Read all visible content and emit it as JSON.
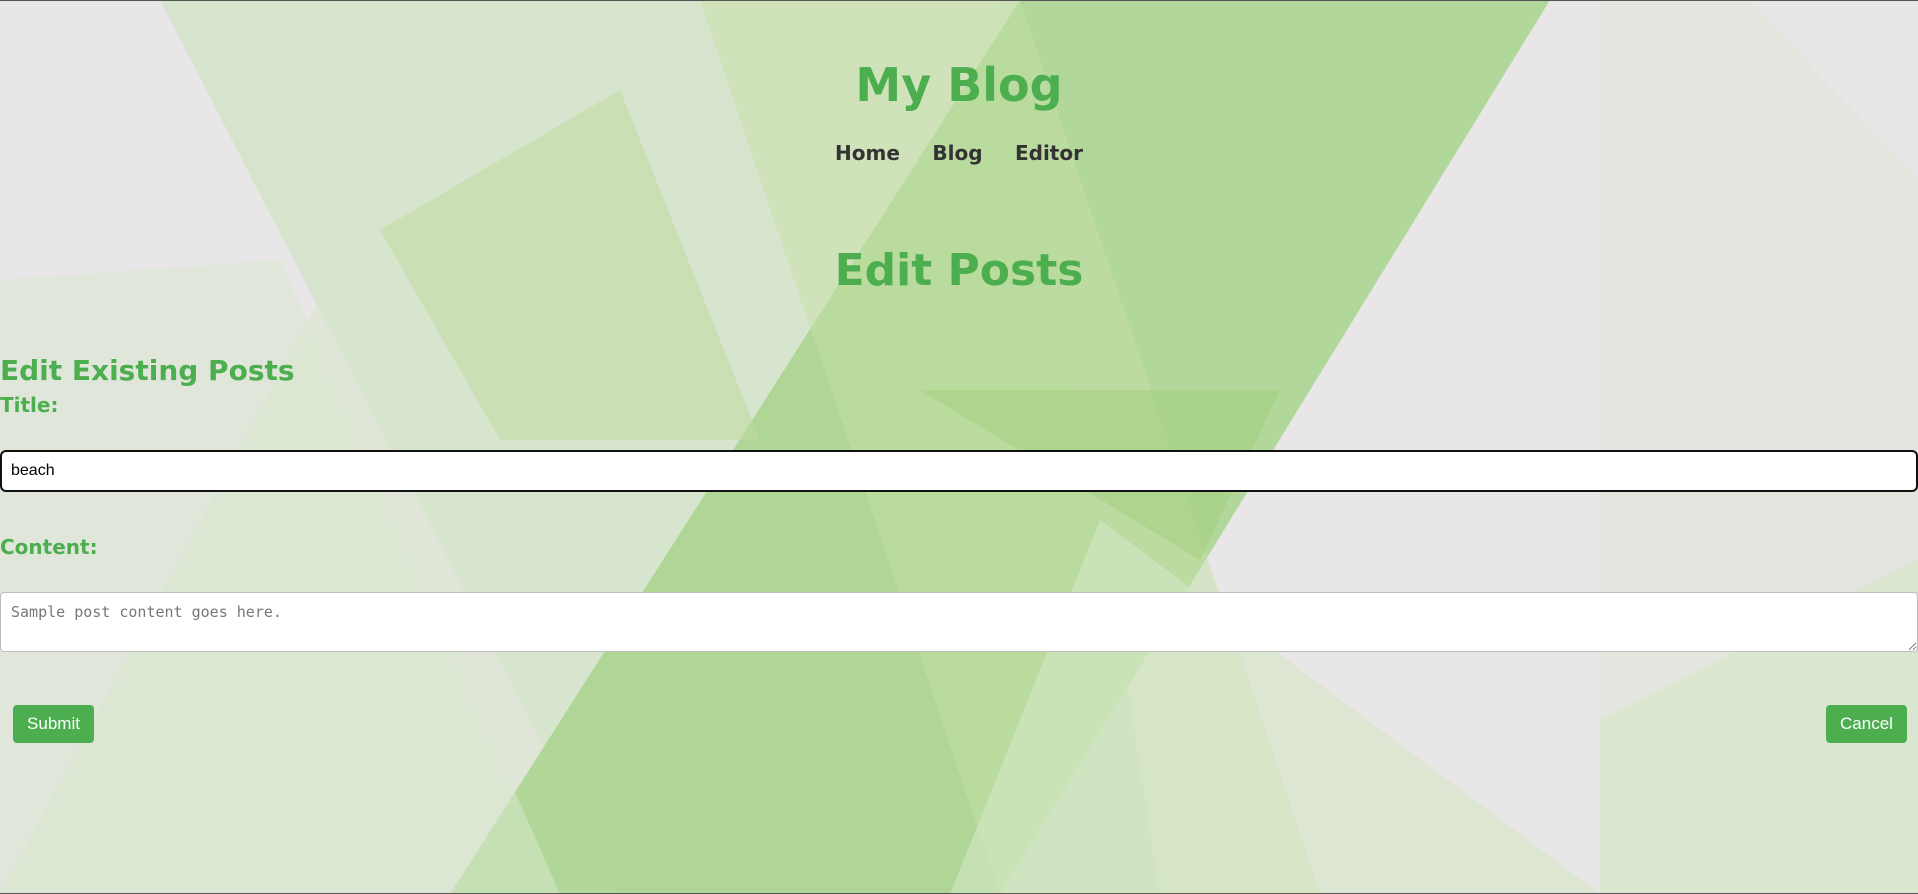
{
  "site": {
    "title": "My Blog"
  },
  "nav": {
    "items": [
      {
        "label": "Home"
      },
      {
        "label": "Blog"
      },
      {
        "label": "Editor"
      }
    ]
  },
  "main": {
    "heading": "Edit Posts",
    "section_heading": "Edit Existing Posts",
    "title_label": "Title:",
    "title_value": "beach",
    "content_label": "Content:",
    "content_placeholder": "Sample post content goes here.",
    "submit_label": "Submit",
    "cancel_label": "Cancel"
  },
  "colors": {
    "accent": "#4cae4f",
    "nav_text": "#333333",
    "background": "#e8e6e7"
  }
}
